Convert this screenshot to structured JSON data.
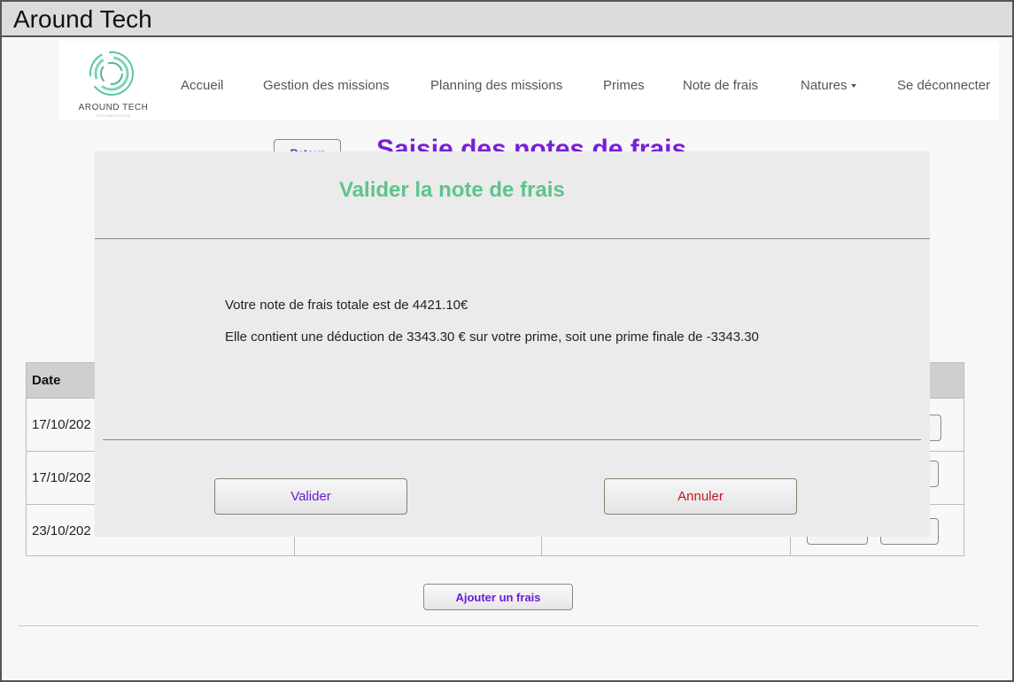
{
  "window": {
    "title": "Around Tech"
  },
  "brand": {
    "name": "AROUND TECH",
    "sub": "TECHNOLOGIE",
    "color": "#5ec4a0"
  },
  "nav": {
    "accueil": "Accueil",
    "gestion": "Gestion des missions",
    "planning": "Planning des missions",
    "primes": "Primes",
    "note_frais": "Note de frais",
    "natures": "Natures",
    "deconnecter": "Se déconnecter"
  },
  "page": {
    "back_label": "Retour",
    "title": "Saisie des notes de frais",
    "add_expense_label": "Ajouter un frais"
  },
  "table": {
    "header_date": "Date",
    "rows": [
      {
        "date": "17/10/202"
      },
      {
        "date": "17/10/202"
      },
      {
        "date": "23/10/202"
      }
    ]
  },
  "modal": {
    "title": "Valider la note de frais",
    "line1": "Votre note de frais totale est de 4421.10€",
    "line2": "Elle contient une déduction de 3343.30 € sur votre prime, soit une prime finale de -3343.30",
    "validate_label": "Valider",
    "cancel_label": "Annuler"
  },
  "colors": {
    "accent_purple": "#6a1bd6",
    "modal_title_green": "#5ec48a",
    "cancel_red": "#c0181f"
  }
}
